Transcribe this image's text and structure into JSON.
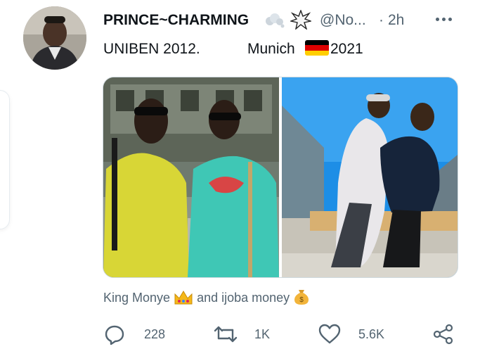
{
  "tweet": {
    "display_name": "PRINCE~CHARMING",
    "handle": "@No...",
    "separator": "·",
    "timestamp": "2h",
    "text_left": "UNIBEN 2012.",
    "text_city": "Munich",
    "text_year": "2021",
    "caption_part1": "King Monye",
    "caption_part2": "and ijoba money",
    "emoji_after_name": [
      "dashing-away-emoji",
      "anger-burst-emoji"
    ],
    "flag": "germany-flag-emoji",
    "caption_emojis": [
      "crown-emoji",
      "money-bag-emoji"
    ]
  },
  "actions": {
    "replies": "228",
    "retweets": "1K",
    "likes": "5.6K"
  },
  "colors": {
    "primary_text": "#0f1419",
    "secondary_text": "#536471",
    "border": "#cfd9de"
  }
}
